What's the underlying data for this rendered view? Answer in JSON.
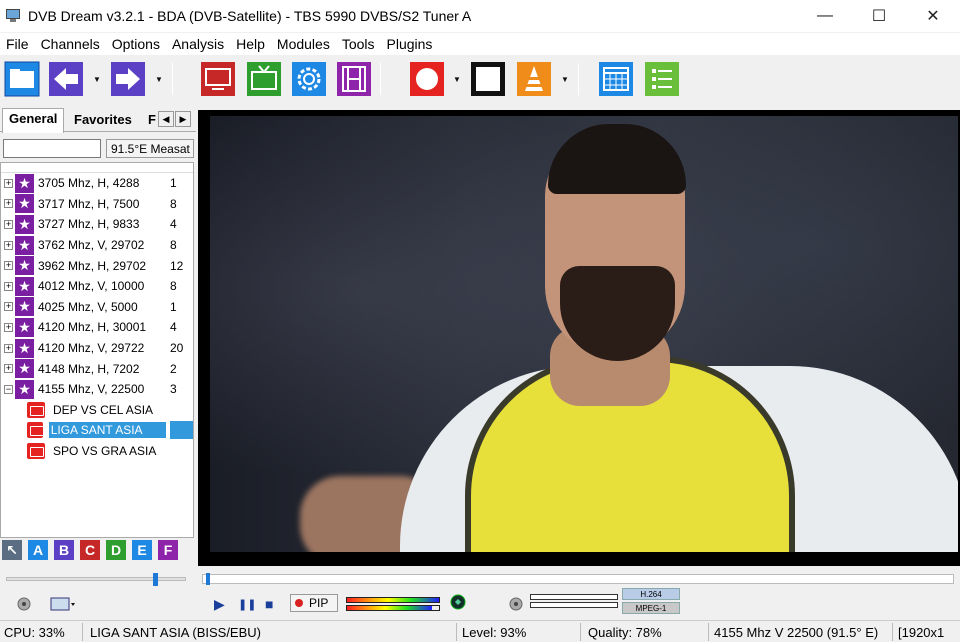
{
  "window": {
    "title": "DVB Dream v3.2.1 - BDA (DVB-Satellite)  - TBS 5990 DVBS/S2 Tuner A",
    "minimize": "—",
    "maximize": "☐",
    "close": "✕"
  },
  "menu": [
    "File",
    "Channels",
    "Options",
    "Analysis",
    "Help",
    "Modules",
    "Tools",
    "Plugins"
  ],
  "toolbar": {
    "buttons": [
      {
        "name": "open-folder",
        "color": "#1e88e5"
      },
      {
        "name": "back-arrow",
        "color": "#5b3fc4"
      },
      {
        "name": "forward-arrow",
        "color": "#5b3fc4"
      },
      {
        "name": "monitor",
        "color": "#c62828"
      },
      {
        "name": "tv",
        "color": "#2e9e2e"
      },
      {
        "name": "settings",
        "color": "#1e88e5"
      },
      {
        "name": "film",
        "color": "#8e24aa"
      },
      {
        "name": "record",
        "color": "#e52421"
      },
      {
        "name": "stop-square",
        "color": "#111111"
      },
      {
        "name": "vlc-cone",
        "color": "#f08c1a"
      },
      {
        "name": "calendar",
        "color": "#1e88e5"
      },
      {
        "name": "list",
        "color": "#6abf3a"
      }
    ]
  },
  "left_panel": {
    "tabs": [
      "General",
      "Favorites",
      "F"
    ],
    "filter_value": "",
    "satellite_select": "91.5°E Measat",
    "transponders": [
      {
        "label": "3705 Mhz, H, 4288",
        "count": "1",
        "expanded": false
      },
      {
        "label": "3717 Mhz, H, 7500",
        "count": "8",
        "expanded": false
      },
      {
        "label": "3727 Mhz, H, 9833",
        "count": "4",
        "expanded": false
      },
      {
        "label": "3762 Mhz, V, 29702",
        "count": "8",
        "expanded": false
      },
      {
        "label": "3962 Mhz, H, 29702",
        "count": "12",
        "expanded": false
      },
      {
        "label": "4012 Mhz, V, 10000",
        "count": "8",
        "expanded": false
      },
      {
        "label": "4025 Mhz, V, 5000",
        "count": "1",
        "expanded": false
      },
      {
        "label": "4120 Mhz, H, 30001",
        "count": "4",
        "expanded": false
      },
      {
        "label": "4120 Mhz, V, 29722",
        "count": "20",
        "expanded": false
      },
      {
        "label": "4148 Mhz, H, 7202",
        "count": "2",
        "expanded": false
      },
      {
        "label": "4155 Mhz, V, 22500",
        "count": "3",
        "expanded": true
      }
    ],
    "channels": [
      {
        "label": "DEP VS CEL ASIA",
        "selected": false
      },
      {
        "label": "LIGA SANT ASIA",
        "selected": true
      },
      {
        "label": "SPO VS GRA ASIA",
        "selected": false
      }
    ],
    "group_letters": [
      {
        "label": "A",
        "color": "#1e88e5"
      },
      {
        "label": "B",
        "color": "#5b3fc4"
      },
      {
        "label": "C",
        "color": "#c62828"
      },
      {
        "label": "D",
        "color": "#2e9e2e"
      },
      {
        "label": "E",
        "color": "#1e88e5"
      },
      {
        "label": "F",
        "color": "#8e24aa"
      }
    ]
  },
  "controls": {
    "play": "▶",
    "pause": "❚❚",
    "stop": "■",
    "pip_label": "PIP",
    "video_codec": "H.264",
    "audio_codec": "MPEG-1"
  },
  "status": {
    "cpu": "CPU: 33%",
    "channel": "LIGA SANT ASIA (BISS/EBU)",
    "level": "Level: 93%",
    "quality": "Quality: 78%",
    "tp": "4155 Mhz  V  22500  (91.5° E)",
    "resolution": "[1920x1"
  }
}
